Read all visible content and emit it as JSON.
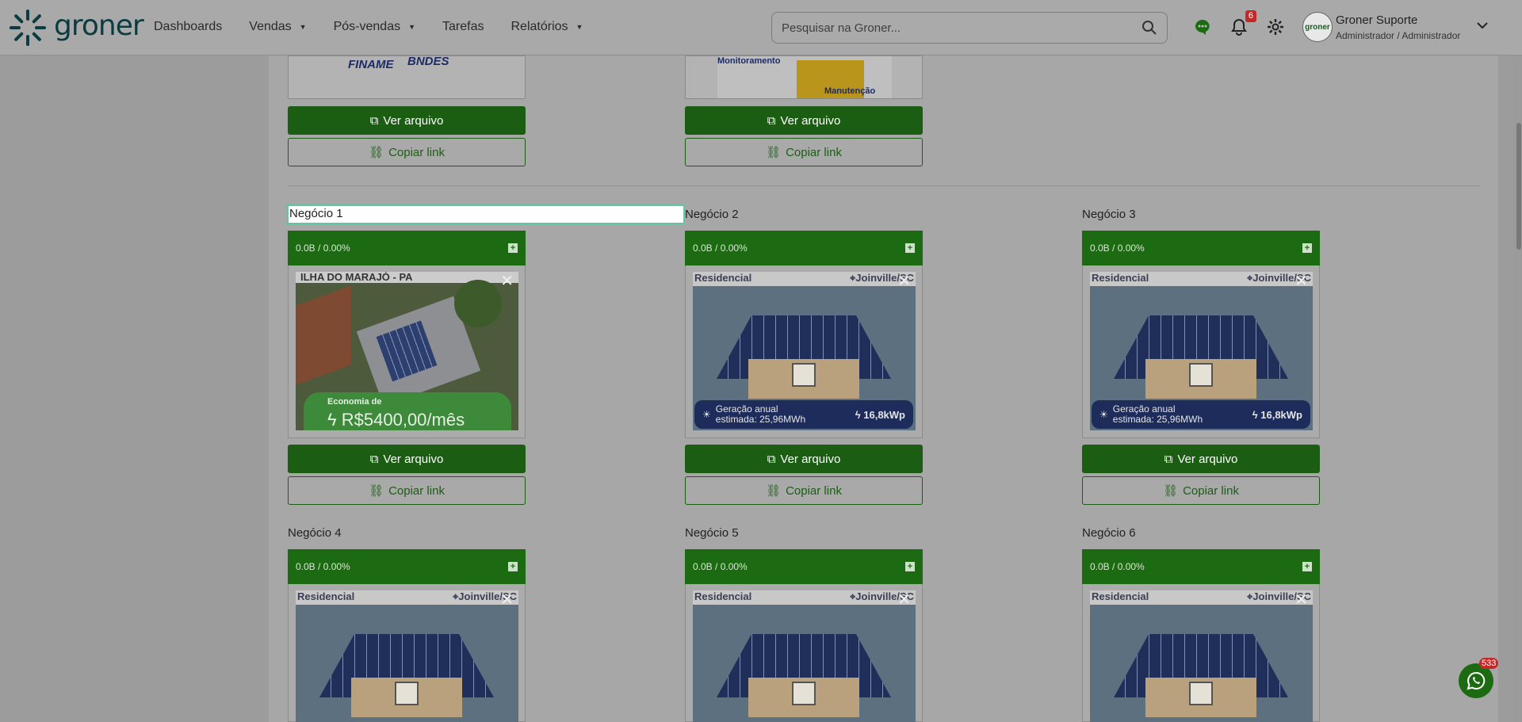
{
  "header": {
    "logo_text": "groner",
    "nav": [
      {
        "label": "Dashboards",
        "dropdown": false
      },
      {
        "label": "Vendas",
        "dropdown": true
      },
      {
        "label": "Pós-vendas",
        "dropdown": true
      },
      {
        "label": "Tarefas",
        "dropdown": false
      },
      {
        "label": "Relatórios",
        "dropdown": true
      }
    ],
    "search_placeholder": "Pesquisar na Groner...",
    "notification_count": "6",
    "user_name": "Groner Suporte",
    "user_role": "Administrador / Administrador",
    "avatar_text": "groner"
  },
  "top_files": [
    {
      "thumb_text_1": "FINAME",
      "thumb_text_2": "BNDES",
      "view_label": "Ver arquivo",
      "copy_label": "Copiar link"
    },
    {
      "thumb_text_1": "Monitoramento",
      "thumb_text_2": "Manutenção",
      "view_label": "Ver arquivo",
      "copy_label": "Copiar link"
    }
  ],
  "business": [
    {
      "title": "Negócio 1",
      "size": "0.0B / 0.00%",
      "variant": "economy",
      "photo_top": "ILHA DO MARAJÓ - PA",
      "econ_label": "Economia de",
      "econ_value": "R$5400,00/mês",
      "view_label": "Ver arquivo",
      "copy_label": "Copiar link"
    },
    {
      "title": "Negócio 2",
      "size": "0.0B / 0.00%",
      "variant": "residencial",
      "type_label": "Residencial",
      "location": "Joinville/SC",
      "gen_label": "Geração anual estimada: 25,96MWh",
      "kwp": "16,8kWp",
      "view_label": "Ver arquivo",
      "copy_label": "Copiar link"
    },
    {
      "title": "Negócio 3",
      "size": "0.0B / 0.00%",
      "variant": "residencial",
      "type_label": "Residencial",
      "location": "Joinville/SC",
      "gen_label": "Geração anual estimada: 25,96MWh",
      "kwp": "16,8kWp",
      "view_label": "Ver arquivo",
      "copy_label": "Copiar link"
    },
    {
      "title": "Negócio 4",
      "size": "0.0B / 0.00%",
      "variant": "residencial",
      "type_label": "Residencial",
      "location": "Joinville/SC"
    },
    {
      "title": "Negócio 5",
      "size": "0.0B / 0.00%",
      "variant": "residencial",
      "type_label": "Residencial",
      "location": "Joinville/SC"
    },
    {
      "title": "Negócio 6",
      "size": "0.0B / 0.00%",
      "variant": "residencial",
      "type_label": "Residencial",
      "location": "Joinville/SC"
    }
  ],
  "chat_badge": "533",
  "colors": {
    "primary": "#1b5e13",
    "accent": "#5ec7a6",
    "badge": "#c62828"
  }
}
